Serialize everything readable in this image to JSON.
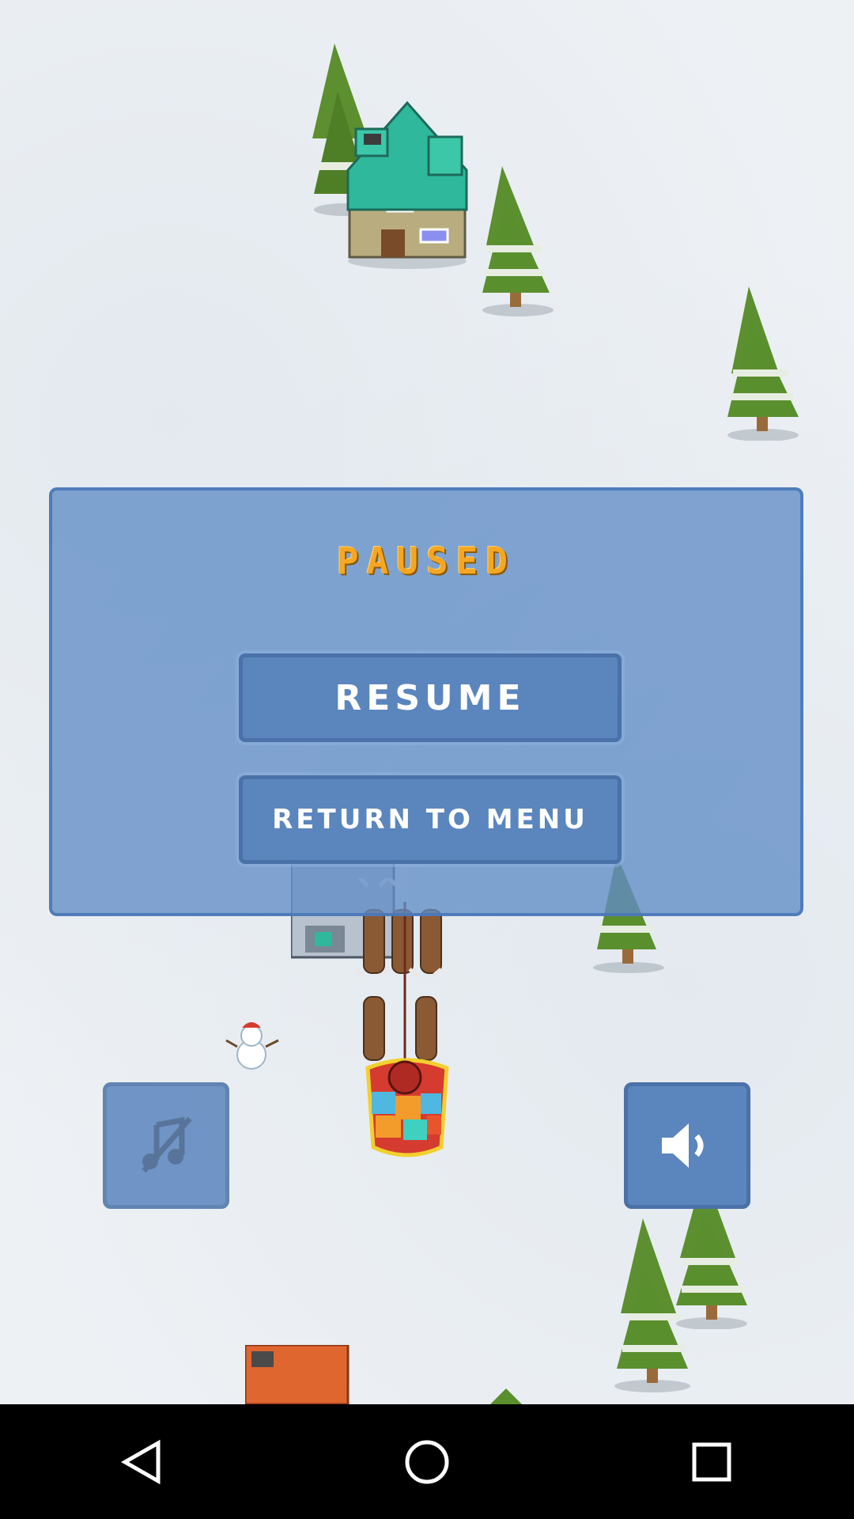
{
  "pause_menu": {
    "title": "PAUSED",
    "resume_label": "RESUME",
    "return_label": "RETURN TO MENU"
  },
  "controls": {
    "music_icon": "music-muted-icon",
    "sound_icon": "speaker-icon"
  },
  "colors": {
    "panel": "#628dc7",
    "button": "#5b85bd",
    "title": "#f5a623",
    "tree": "#5a8f2e",
    "roof": "#2fb89c"
  },
  "navigation": {
    "back_icon": "back-triangle-icon",
    "home_icon": "home-circle-icon",
    "recents_icon": "recents-square-icon"
  }
}
